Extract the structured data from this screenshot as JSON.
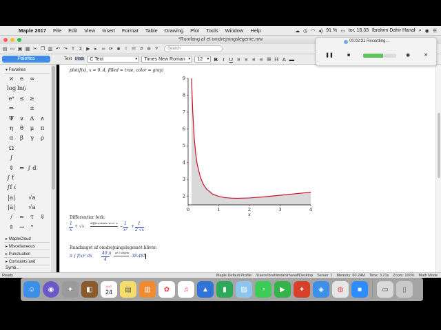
{
  "menubar": {
    "app": "Maple 2017",
    "items": [
      "File",
      "Edit",
      "View",
      "Insert",
      "Format",
      "Table",
      "Drawing",
      "Plot",
      "Tools",
      "Window",
      "Help"
    ],
    "battery": "91 %",
    "clock": "tor. 18.33",
    "user": "Ibrahim Dahir Hanaf"
  },
  "window": {
    "title": "*Rumfang af et omdrejningslegeme.mw"
  },
  "toolbar": {
    "search_placeholder": "Search"
  },
  "formatbar": {
    "palettes_label": "Palettes",
    "text_tab": "Text",
    "math_tab": "Math",
    "style": "C  Text",
    "font": "Times New Roman",
    "size": "12",
    "bold": "B",
    "italic": "I",
    "underline": "U"
  },
  "palettes": {
    "favorites": "Favorites",
    "symbols": [
      "×",
      "e",
      "∞",
      "",
      "log₁₀(a)",
      "ln(a)",
      "",
      "",
      "eᵃ",
      "≤",
      "≥",
      "",
      "⇒",
      "",
      "±",
      "",
      "Ψ",
      "∨",
      "Δ",
      "∧",
      "η",
      "θ",
      "μ",
      "π",
      "α",
      "β",
      "γ",
      "ρ",
      "Ω",
      "",
      "",
      "",
      "∫",
      "",
      "",
      "",
      "⇕",
      "⇔",
      "∫ dx",
      "",
      "∫ f dx",
      "",
      "",
      "",
      "∫f dx",
      "",
      "",
      "",
      "|a|",
      "",
      "√a",
      "",
      "|a|",
      "",
      "√a",
      "",
      "/",
      "≈",
      "τ",
      "⇓",
      "⇑",
      "→",
      "°",
      ""
    ],
    "sections": [
      "MapleCloud",
      "Miscellaneous",
      "Punctuation",
      "Constants and Symb..."
    ]
  },
  "document": {
    "command": "plot(f(x), x = 0..4, filled = true, color = gray)",
    "diff_heading": "Differentier fork:",
    "diff_lhs_a": "1",
    "diff_lhs_b": "x",
    "diff_lhs_op": "+ √x",
    "diff_arrow_label": "differentiate w.r.t. x",
    "diff_rhs_sign": "−",
    "diff_rhs_a": "1",
    "diff_rhs_b": "x²",
    "diff_rhs_op": "+",
    "diff_rhs_c": "1",
    "diff_rhs_d": "2 √x",
    "volume_heading": "Rumfanget af omdrejningslegemet bliver:",
    "volume_expr": "π ∫ f(x)² dx",
    "volume_exact_num": "49 π",
    "volume_exact_den": "4",
    "volume_arrow_label": "at 5 digits",
    "volume_numeric": "38.485"
  },
  "chart_data": {
    "type": "area",
    "title": "",
    "xlabel": "x",
    "ylabel": "",
    "xlim": [
      0,
      4
    ],
    "ylim": [
      1.5,
      9
    ],
    "xticks": [
      0,
      1,
      2,
      3,
      4
    ],
    "yticks": [
      2,
      3,
      4,
      5,
      6,
      7,
      8,
      9
    ],
    "fill_color": "#d9d9d9",
    "line_color": "#c8102e",
    "x": [
      0.11,
      0.15,
      0.2,
      0.25,
      0.3,
      0.4,
      0.5,
      0.6,
      0.8,
      1.0,
      1.2,
      1.4,
      1.6,
      1.8,
      2.0,
      2.5,
      3.0,
      3.5,
      4.0
    ],
    "y": [
      9.42,
      7.05,
      5.45,
      4.5,
      3.88,
      3.13,
      2.71,
      2.44,
      2.14,
      2.0,
      1.93,
      1.9,
      1.89,
      1.9,
      1.91,
      1.98,
      2.07,
      2.16,
      2.25
    ]
  },
  "statusbar": {
    "left": "Ready",
    "profile": "Maple Default Profile",
    "path": "/Users/ibrahimdahirhanaf/Desktop",
    "server": "Server: 1",
    "memory": "Memory: 60.24M",
    "time": "Time: 3.21s",
    "zoom": "Zoom: 100%",
    "mode": "Math Mode"
  },
  "recorder": {
    "timer": "00:02:31 Recording...",
    "level": 0.6
  },
  "dock": {
    "calendar_month": "AUG",
    "calendar_day": "24",
    "apps": [
      "finder",
      "siri",
      "launchpad",
      "calendar",
      "notes",
      "books",
      "photos",
      "music",
      "keynote",
      "numbers",
      "preview",
      "messages",
      "facetime",
      "maple",
      "safari",
      "chrome",
      "zoom",
      "screenshot",
      "trash"
    ]
  }
}
